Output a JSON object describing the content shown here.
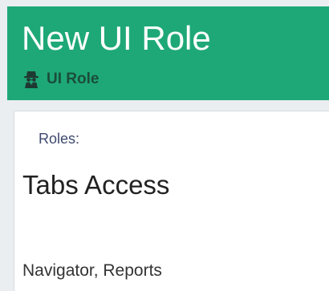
{
  "header": {
    "title": "New UI Role",
    "subtitle": "UI Role",
    "subtitle_icon": "spy-icon",
    "background_color": "#1ea878"
  },
  "panel": {
    "roles_label": "Roles:",
    "section_title": "Tabs Access",
    "tabs_value": "Navigator, Reports"
  }
}
